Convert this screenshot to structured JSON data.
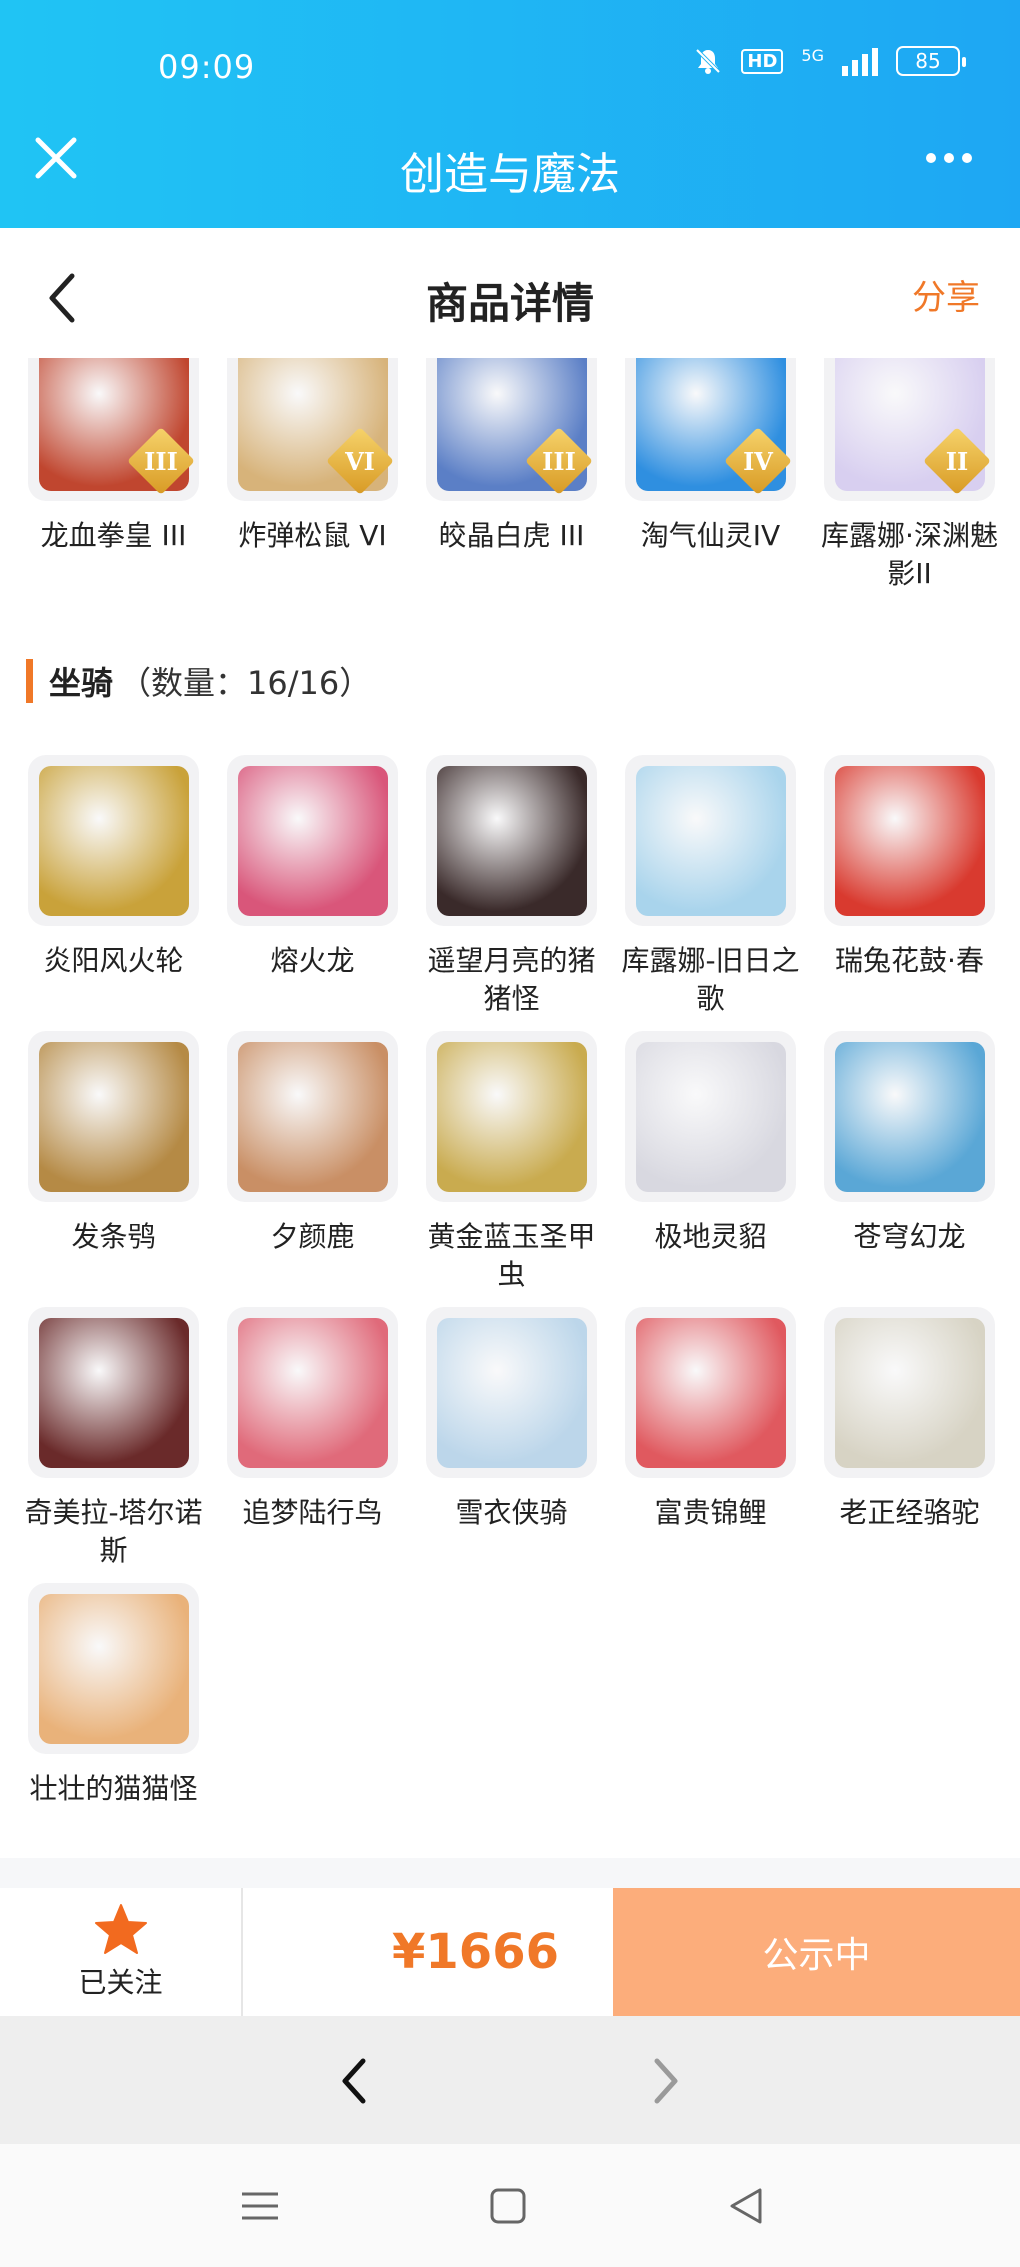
{
  "status_bar": {
    "time": "09:09",
    "network": "5G",
    "hd": "HD",
    "battery": "85"
  },
  "app": {
    "title": "创造与魔法"
  },
  "header": {
    "title": "商品详情",
    "share_label": "分享"
  },
  "top_row": [
    {
      "name": "龙血拳皇 III",
      "tier": "III",
      "color": "#c0462f"
    },
    {
      "name": "炸弹松鼠 VI",
      "tier": "VI",
      "color": "#d7b37a"
    },
    {
      "name": "皎晶白虎 III",
      "tier": "III",
      "color": "#5b7fc6"
    },
    {
      "name": "淘气仙灵IV",
      "tier": "IV",
      "color": "#2f8fe0"
    },
    {
      "name": "库露娜·深渊魅影II",
      "tier": "II",
      "color": "#d8cff0"
    }
  ],
  "mounts_section": {
    "title": "坐骑",
    "count": "（数量：16/16）"
  },
  "mounts": [
    {
      "name": "炎阳风火轮",
      "color": "#c9a23a"
    },
    {
      "name": "熔火龙",
      "color": "#d9567a"
    },
    {
      "name": "遥望月亮的猪猪怪",
      "color": "#3a2a2a"
    },
    {
      "name": "库露娜-旧日之歌",
      "color": "#a9d4ec"
    },
    {
      "name": "瑞兔花鼓·春",
      "color": "#d93a2f"
    },
    {
      "name": "发条鸮",
      "color": "#b58a45"
    },
    {
      "name": "夕颜鹿",
      "color": "#c98f65"
    },
    {
      "name": "黄金蓝玉圣甲虫",
      "color": "#c9ab4f"
    },
    {
      "name": "极地灵貂",
      "color": "#d8d8e0"
    },
    {
      "name": "苍穹幻龙",
      "color": "#5aa7d6"
    },
    {
      "name": "奇美拉-塔尔诺斯",
      "color": "#6a2a2a"
    },
    {
      "name": "追梦陆行鸟",
      "color": "#e06a7a"
    },
    {
      "name": "雪衣侠骑",
      "color": "#bcd6ea"
    },
    {
      "name": "富贵锦鲤",
      "color": "#e0595f"
    },
    {
      "name": "老正经骆驼",
      "color": "#d7d3c4"
    },
    {
      "name": "壮壮的猫猫怪",
      "color": "#e9b27a"
    }
  ],
  "action_bar": {
    "follow_label": "已关注",
    "price": "¥1666",
    "status_label": "公示中"
  },
  "colors": {
    "accent": "#f07828",
    "topbar": "#1ea7f3",
    "status_button": "#fcad7b"
  }
}
